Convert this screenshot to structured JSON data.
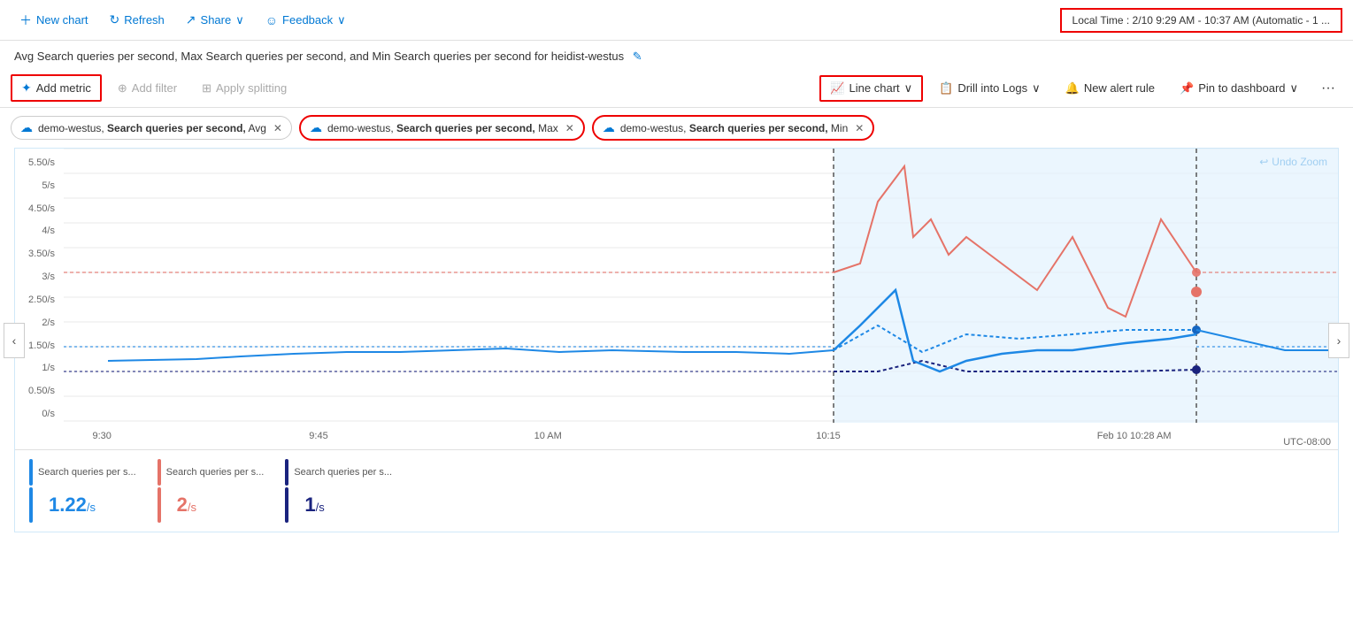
{
  "toolbar": {
    "new_chart": "New chart",
    "refresh": "Refresh",
    "share": "Share",
    "feedback": "Feedback",
    "time_range": "Local Time : 2/10 9:29 AM - 10:37 AM (Automatic - 1 ..."
  },
  "chart_title": "Avg Search queries per second, Max Search queries per second, and Min Search queries per second for heidist-westus",
  "metrics_bar": {
    "add_metric": "Add metric",
    "add_filter": "Add filter",
    "apply_splitting": "Apply splitting",
    "line_chart": "Line chart",
    "drill_into_logs": "Drill into Logs",
    "new_alert_rule": "New alert rule",
    "pin_to_dashboard": "Pin to dashboard"
  },
  "metric_tags": [
    {
      "id": "tag1",
      "text": "demo-westus, Search queries per second, Avg",
      "highlighted": false
    },
    {
      "id": "tag2",
      "text": "demo-westus, Search queries per second, Max",
      "highlighted": true
    },
    {
      "id": "tag3",
      "text": "demo-westus, Search queries per second, Min",
      "highlighted": true
    }
  ],
  "chart": {
    "undo_zoom": "Undo Zoom",
    "y_labels": [
      "5.50/s",
      "5/s",
      "4.50/s",
      "4/s",
      "3.50/s",
      "3/s",
      "2.50/s",
      "2/s",
      "1.50/s",
      "1/s",
      "0.50/s",
      "0/s"
    ],
    "x_labels": [
      "9:30",
      "9:45",
      "10 AM",
      "10:15",
      "Feb 10 10:28 AM"
    ],
    "utc": "UTC-08:00"
  },
  "legend": [
    {
      "id": "leg1",
      "label": "Search queries per s...",
      "color": "#1e88e5",
      "value": "1.22",
      "unit": "/s"
    },
    {
      "id": "leg2",
      "label": "Search queries per s...",
      "color": "#e57368",
      "value": "2",
      "unit": "/s"
    },
    {
      "id": "leg3",
      "label": "Search queries per s...",
      "color": "#1a237e",
      "value": "1",
      "unit": "/s"
    }
  ]
}
